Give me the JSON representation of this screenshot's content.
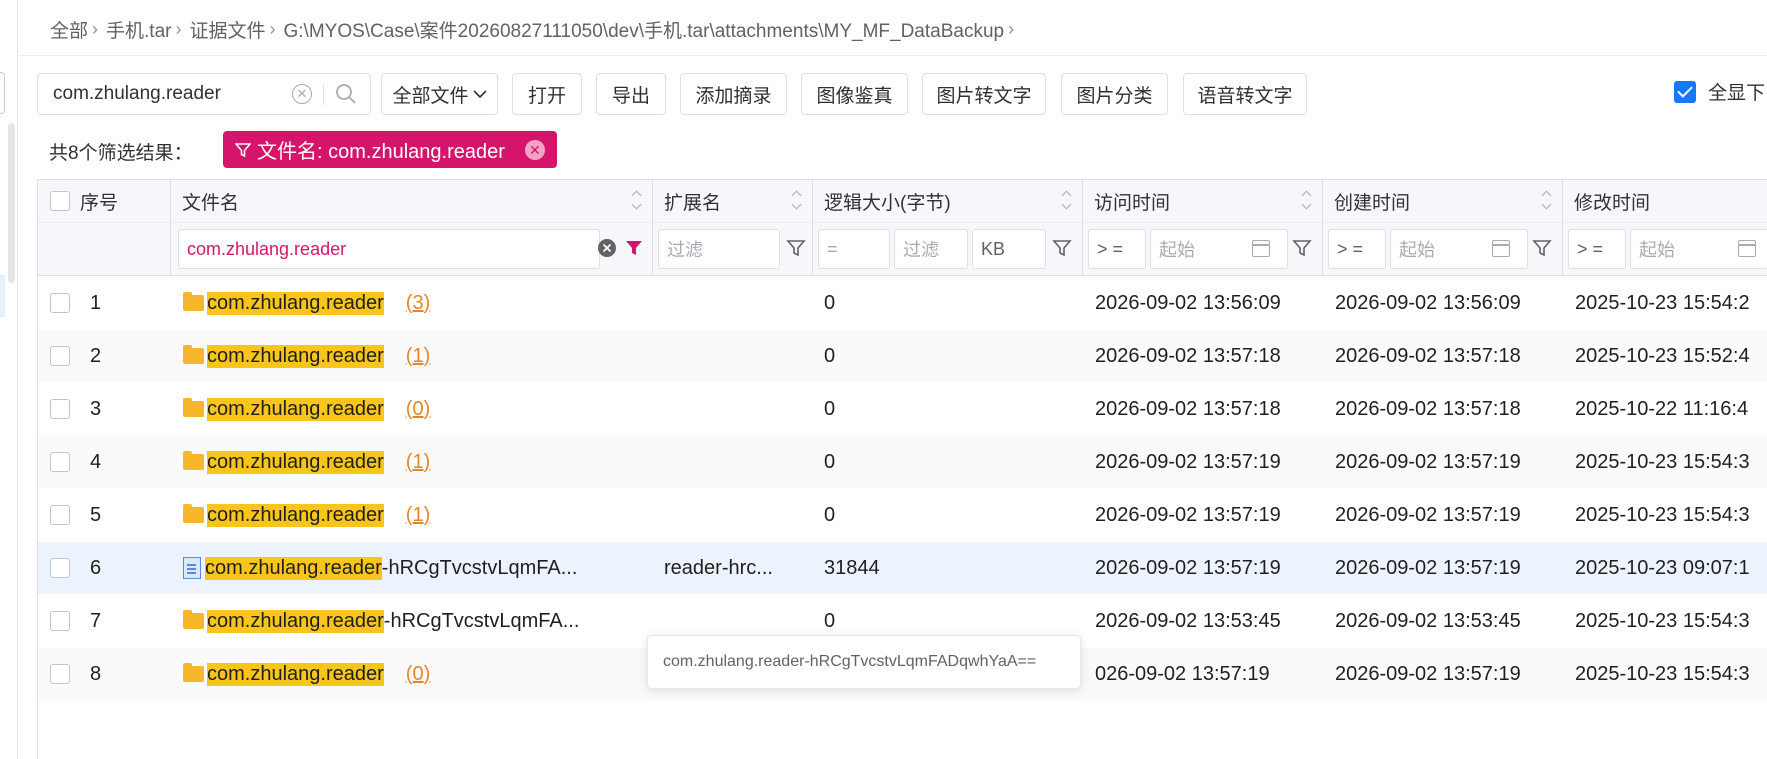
{
  "breadcrumb": [
    "全部",
    "手机.tar",
    "证据文件",
    "G:\\MYOS\\Case\\案件20260827111050\\dev\\手机.tar\\attachments\\MY_MF_DataBackup"
  ],
  "search": {
    "value": "com.zhulang.reader"
  },
  "toolbar": {
    "file_type": "全部文件",
    "buttons": [
      "打开",
      "导出",
      "添加摘录",
      "图像鉴真",
      "图片转文字",
      "图片分类",
      "语音转文字"
    ],
    "show_all": "全显下"
  },
  "filter": {
    "result_count": "共8个筛选结果：",
    "tag": "文件名: com.zhulang.reader"
  },
  "table": {
    "headers": {
      "index": "序号",
      "name": "文件名",
      "ext": "扩展名",
      "size": "逻辑大小(字节)",
      "access": "访问时间",
      "create": "创建时间",
      "modify": "修改时间"
    },
    "filters": {
      "name_value": "com.zhulang.reader",
      "ext_placeholder": "过滤",
      "size_op": "=",
      "size_placeholder": "过滤",
      "size_unit": "KB",
      "access_op": "> =",
      "access_start": "起始",
      "create_op": "> =",
      "create_start": "起始",
      "modify_op": "> =",
      "modify_start": "起始"
    },
    "rows": [
      {
        "index": "1",
        "icon": "folder",
        "match": "com.zhulang.reader",
        "rest": "",
        "count": "(3)",
        "ext": "",
        "size": "0",
        "access": "2026-09-02 13:56:09",
        "create": "2026-09-02 13:56:09",
        "modify": "2025-10-23 15:54:2"
      },
      {
        "index": "2",
        "icon": "folder",
        "match": "com.zhulang.reader",
        "rest": "",
        "count": "(1)",
        "ext": "",
        "size": "0",
        "access": "2026-09-02 13:57:18",
        "create": "2026-09-02 13:57:18",
        "modify": "2025-10-23 15:52:4"
      },
      {
        "index": "3",
        "icon": "folder",
        "match": "com.zhulang.reader",
        "rest": "",
        "count": "(0)",
        "ext": "",
        "size": "0",
        "access": "2026-09-02 13:57:18",
        "create": "2026-09-02 13:57:18",
        "modify": "2025-10-22 11:16:4"
      },
      {
        "index": "4",
        "icon": "folder",
        "match": "com.zhulang.reader",
        "rest": "",
        "count": "(1)",
        "ext": "",
        "size": "0",
        "access": "2026-09-02 13:57:19",
        "create": "2026-09-02 13:57:19",
        "modify": "2025-10-23 15:54:3"
      },
      {
        "index": "5",
        "icon": "folder",
        "match": "com.zhulang.reader",
        "rest": "",
        "count": "(1)",
        "ext": "",
        "size": "0",
        "access": "2026-09-02 13:57:19",
        "create": "2026-09-02 13:57:19",
        "modify": "2025-10-23 15:54:3"
      },
      {
        "index": "6",
        "icon": "file",
        "match": "com.zhulang.reader",
        "rest": "-hRCgTvcstvLqmFA...",
        "count": "",
        "ext": "reader-hrc...",
        "size": "31844",
        "access": "2026-09-02 13:57:19",
        "create": "2026-09-02 13:57:19",
        "modify": "2025-10-23 09:07:1"
      },
      {
        "index": "7",
        "icon": "folder",
        "match": "com.zhulang.reader",
        "rest": "-hRCgTvcstvLqmFA...",
        "count": "",
        "ext": "",
        "size": "0",
        "access": "2026-09-02 13:53:45",
        "create": "2026-09-02 13:53:45",
        "modify": "2025-10-23 15:54:3"
      },
      {
        "index": "8",
        "icon": "folder",
        "match": "com.zhulang.reader",
        "rest": "",
        "count": "(0)",
        "ext": "",
        "size": "",
        "access": "026-09-02 13:57:19",
        "create": "2026-09-02 13:57:19",
        "modify": "2025-10-23 15:54:3"
      }
    ]
  },
  "tooltip": "com.zhulang.reader-hRCgTvcstvLqmFADqwhYaA==",
  "colors": {
    "accent": "#1677ff",
    "tag": "#d5156b",
    "highlight": "#f9c51b",
    "count_link": "#e6862a",
    "folder": "#f8b62d",
    "selected_row": "#ecf3fc"
  }
}
